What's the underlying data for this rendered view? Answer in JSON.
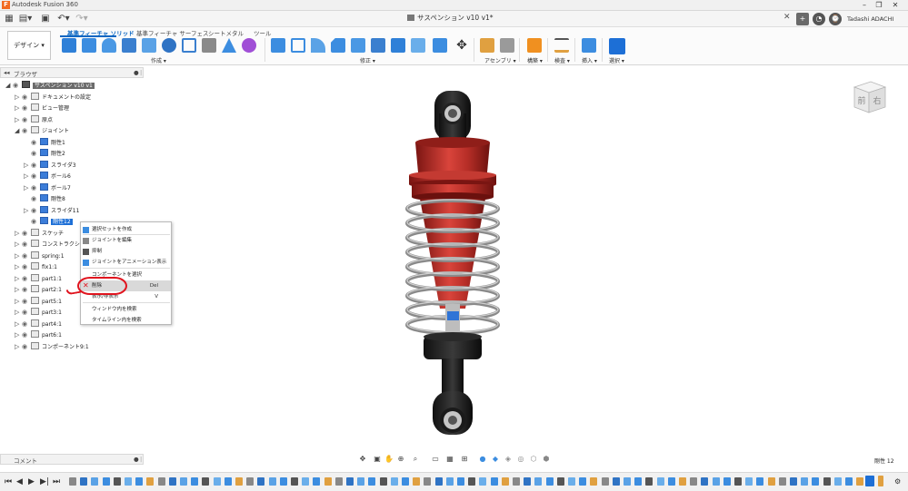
{
  "app": {
    "title": "Autodesk Fusion 360",
    "logo_letter": "F"
  },
  "document": {
    "tab_title": "サスペンション v10 v1*",
    "close_symbol": "✕"
  },
  "user": {
    "name": "Tadashi ADACHI"
  },
  "design_button": {
    "label": "デザイン ▾"
  },
  "ribbon": {
    "tabs": [
      {
        "label": "基準フィーチャ ソリッド",
        "active": true
      },
      {
        "label": "基準フィーチャ サーフェス",
        "active": false
      },
      {
        "label": "シートメタル",
        "active": false
      },
      {
        "label": "ツール",
        "active": false
      }
    ],
    "groups": [
      "作成 ▾",
      "修正 ▾",
      "アセンブリ ▾",
      "構築 ▾",
      "検査 ▾",
      "挿入 ▾",
      "選択 ▾"
    ]
  },
  "browser": {
    "title": "ブラウザ",
    "rows": [
      {
        "label": "サスペンション v10 v1",
        "level": 0,
        "tri": "◢",
        "selected": false,
        "root": true
      },
      {
        "label": "ドキュメントの設定",
        "level": 1,
        "tri": "▷",
        "selected": false
      },
      {
        "label": "ビュー管理",
        "level": 1,
        "tri": "▷",
        "selected": false
      },
      {
        "label": "原点",
        "level": 1,
        "tri": "▷",
        "selected": false
      },
      {
        "label": "ジョイント",
        "level": 1,
        "tri": "◢",
        "selected": false
      },
      {
        "label": "剛性1",
        "level": 2,
        "tri": "",
        "selected": false,
        "joint": true
      },
      {
        "label": "剛性2",
        "level": 2,
        "tri": "",
        "selected": false,
        "joint": true
      },
      {
        "label": "スライダ3",
        "level": 2,
        "tri": "▷",
        "selected": false,
        "joint": true
      },
      {
        "label": "ボール6",
        "level": 2,
        "tri": "▷",
        "selected": false,
        "joint": true
      },
      {
        "label": "ボール7",
        "level": 2,
        "tri": "▷",
        "selected": false,
        "joint": true
      },
      {
        "label": "剛性8",
        "level": 2,
        "tri": "",
        "selected": false,
        "joint": true
      },
      {
        "label": "スライダ11",
        "level": 2,
        "tri": "▷",
        "selected": false,
        "joint": true
      },
      {
        "label": "剛性12",
        "level": 2,
        "tri": "",
        "selected": true,
        "joint": true
      },
      {
        "label": "スケッチ",
        "level": 1,
        "tri": "▷",
        "selected": false
      },
      {
        "label": "コンストラクション",
        "level": 1,
        "tri": "▷",
        "selected": false
      },
      {
        "label": "spring:1",
        "level": 1,
        "tri": "▷",
        "selected": false
      },
      {
        "label": "fix1:1",
        "level": 1,
        "tri": "▷",
        "selected": false
      },
      {
        "label": "part1:1",
        "level": 1,
        "tri": "▷",
        "selected": false
      },
      {
        "label": "part2:1",
        "level": 1,
        "tri": "▷",
        "selected": false
      },
      {
        "label": "part5:1",
        "level": 1,
        "tri": "▷",
        "selected": false
      },
      {
        "label": "part3:1",
        "level": 1,
        "tri": "▷",
        "selected": false
      },
      {
        "label": "part4:1",
        "level": 1,
        "tri": "▷",
        "selected": false
      },
      {
        "label": "part6:1",
        "level": 1,
        "tri": "▷",
        "selected": false
      },
      {
        "label": "コンポーネント9:1",
        "level": 1,
        "tri": "▷",
        "selected": false
      }
    ]
  },
  "context_menu": {
    "items": [
      {
        "label": "選択セットを作成",
        "shortcut": "",
        "highlight": false
      },
      {
        "label": "ジョイントを編集",
        "shortcut": "",
        "highlight": false
      },
      {
        "label": "抑制",
        "shortcut": "",
        "highlight": false
      },
      {
        "label": "ジョイントをアニメーション表示",
        "shortcut": "",
        "highlight": false
      },
      {
        "label": "コンポーネントを選択",
        "shortcut": "",
        "highlight": false
      },
      {
        "label": "削除",
        "shortcut": "Del",
        "highlight": true
      },
      {
        "label": "表示/非表示",
        "shortcut": "V",
        "highlight": false
      },
      {
        "label": "ウィンドウ内を検索",
        "shortcut": "",
        "highlight": false
      },
      {
        "label": "タイムライン内を検索",
        "shortcut": "",
        "highlight": false
      }
    ]
  },
  "viewcube": {
    "front": "前",
    "right": "右"
  },
  "comments": {
    "title": "コメント"
  },
  "status": {
    "selection": "剛性 12"
  },
  "colors": {
    "accent": "#0a66c2",
    "selection": "#1d6fd6",
    "annotation": "#e0141e",
    "body_red": "#c8302a",
    "spring": "#8a8a8a"
  }
}
